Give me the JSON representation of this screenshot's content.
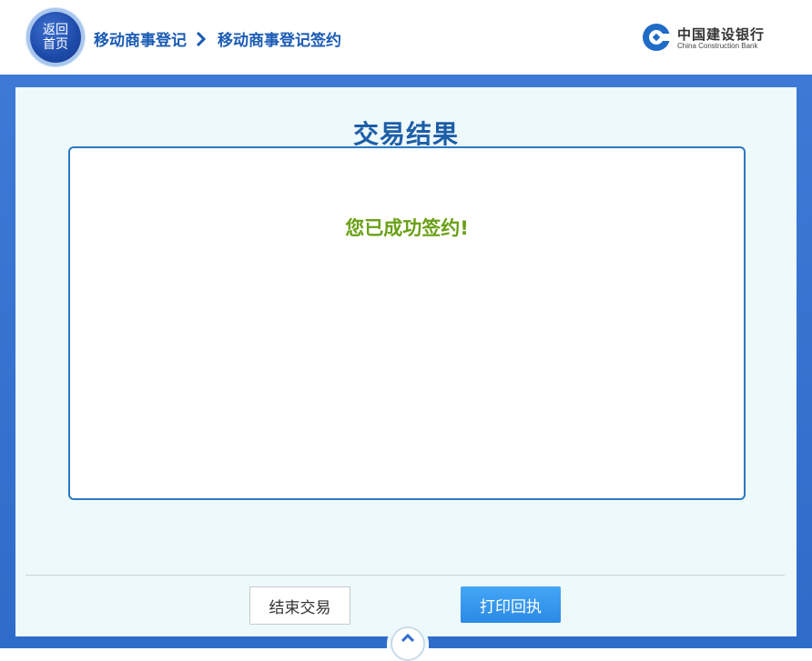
{
  "header": {
    "home_button": {
      "line1": "返回",
      "line2": "首页"
    },
    "breadcrumb": {
      "items": [
        "移动商事登记",
        "移动商事登记签约"
      ],
      "separator_icon": "chevron-right-icon"
    },
    "logo": {
      "cn": "中国建设银行",
      "en": "China Construction Bank",
      "icon": "ccb-logo-icon"
    }
  },
  "main": {
    "title": "交易结果",
    "result_message": "您已成功签约!",
    "buttons": {
      "end": "结束交易",
      "print": "打印回执"
    },
    "scroll_up_icon": "chevron-up-icon"
  },
  "colors": {
    "brand_blue": "#1d5ea8",
    "frame_blue": "#3d7ad6",
    "success_green": "#6aa015",
    "primary_button": "#2a8ae6"
  }
}
